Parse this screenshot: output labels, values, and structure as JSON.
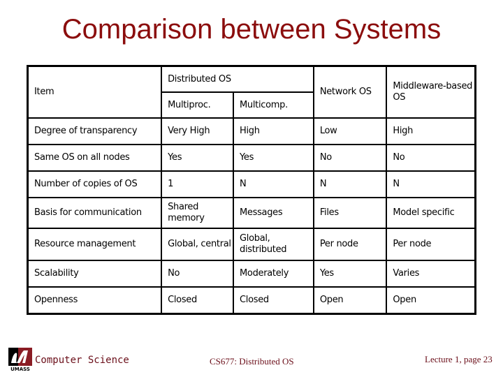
{
  "slide": {
    "title": "Comparison between Systems"
  },
  "table": {
    "header": {
      "item": "Item",
      "distributed_os": "Distributed OS",
      "multiproc": "Multiproc.",
      "multicomp": "Multicomp.",
      "network_os": "Network OS",
      "middleware_os": "Middleware-based OS"
    },
    "rows": [
      {
        "item": "Degree of transparency",
        "multiproc": "Very High",
        "multicomp": "High",
        "network": "Low",
        "middleware": "High"
      },
      {
        "item": "Same OS on all nodes",
        "multiproc": "Yes",
        "multicomp": "Yes",
        "network": "No",
        "middleware": "No"
      },
      {
        "item": "Number of copies of OS",
        "multiproc": "1",
        "multicomp": "N",
        "network": "N",
        "middleware": "N"
      },
      {
        "item": "Basis for communication",
        "multiproc": "Shared memory",
        "multicomp": "Messages",
        "network": "Files",
        "middleware": "Model specific"
      },
      {
        "item": "Resource management",
        "multiproc": "Global, central",
        "multicomp": "Global, distributed",
        "network": "Per node",
        "middleware": "Per node"
      },
      {
        "item": "Scalability",
        "multiproc": "No",
        "multicomp": "Moderately",
        "network": "Yes",
        "middleware": "Varies"
      },
      {
        "item": "Openness",
        "multiproc": "Closed",
        "multicomp": "Closed",
        "network": "Open",
        "middleware": "Open"
      }
    ]
  },
  "footer": {
    "logo_text": "UMASS",
    "department": "Computer Science",
    "course": "CS677: Distributed OS",
    "page": "Lecture 1, page 23"
  },
  "colors": {
    "title": "#8b0d0d",
    "footer_text": "#6b0f1a",
    "logo_maroon": "#8a1c24"
  }
}
